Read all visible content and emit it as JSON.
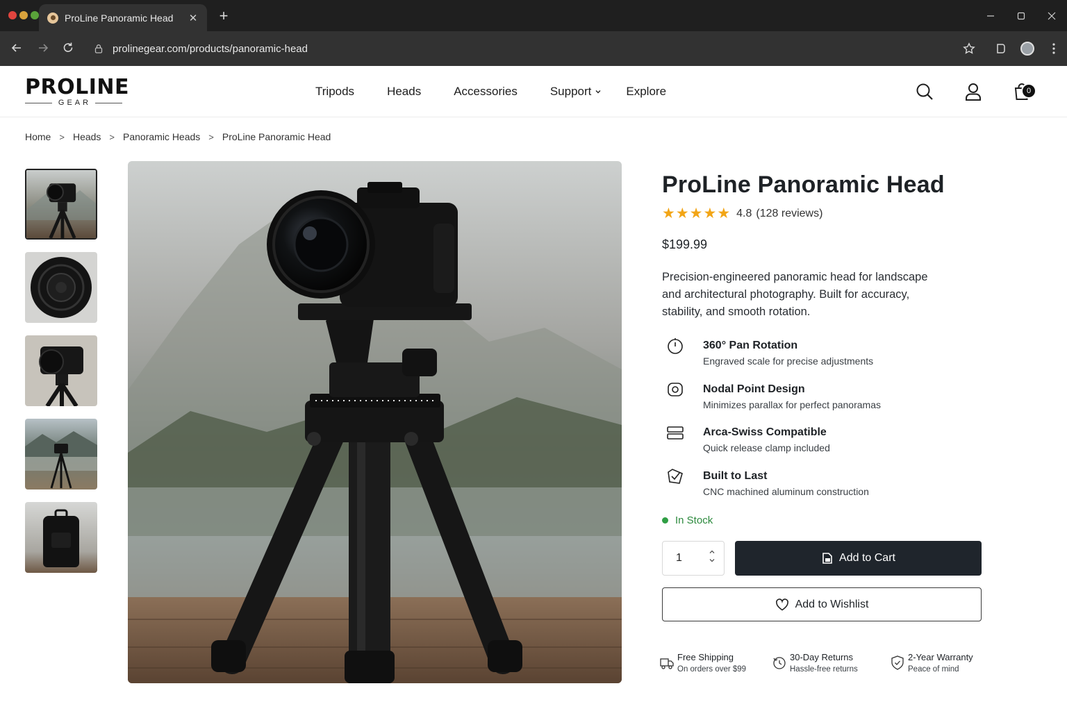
{
  "browser": {
    "tab_title": "ProLine Panoramic Head",
    "tab_close": "✕",
    "new_tab": "+",
    "url": "prolinegear.com/products/panoramic-head"
  },
  "site": {
    "logo_main": "PROLINE",
    "logo_sub": "GEAR",
    "nav": [
      "Tripods",
      "Heads",
      "Accessories",
      "Support",
      "Explore"
    ],
    "cart_count": "0"
  },
  "breadcrumb": [
    "Home",
    "Heads",
    "Panoramic Heads",
    "ProLine Panoramic Head"
  ],
  "breadcrumb_separator": ">",
  "product": {
    "title": "ProLine Panoramic Head",
    "rating_value": "4.8",
    "rating_count": "(128 reviews)",
    "stars_filled": 5,
    "star_glyph": "★",
    "price": "$199.99",
    "description": "Precision-engineered panoramic head for landscape and architectural photography. Built for accuracy, stability, and smooth rotation.",
    "features": [
      {
        "title": "360° Pan Rotation",
        "subtitle": "Engraved scale for precise adjustments",
        "icon": "rotation-dial-icon"
      },
      {
        "title": "Nodal Point Design",
        "subtitle": "Minimizes parallax for perfect panoramas",
        "icon": "nodal-point-icon"
      },
      {
        "title": "Arca-Swiss Compatible",
        "subtitle": "Quick release clamp included",
        "icon": "clamp-icon"
      },
      {
        "title": "Built to Last",
        "subtitle": "CNC machined aluminum construction",
        "icon": "durable-badge-icon"
      }
    ],
    "stock_status": "In Stock",
    "quantity": "1",
    "add_to_cart": "Add to Cart",
    "add_to_wishlist": "Add to Wishlist"
  },
  "perks": [
    {
      "title": "Free Shipping",
      "subtitle": "On orders over $99",
      "icon": "shipping-truck-icon"
    },
    {
      "title": "30-Day Returns",
      "subtitle": "Hassle-free returns",
      "icon": "returns-clock-icon"
    },
    {
      "title": "2-Year Warranty",
      "subtitle": "Peace of mind",
      "icon": "warranty-shield-icon"
    }
  ],
  "colors": {
    "accent_dark": "#1f252c",
    "star": "#f2a516",
    "in_stock": "#2d8a3e"
  }
}
